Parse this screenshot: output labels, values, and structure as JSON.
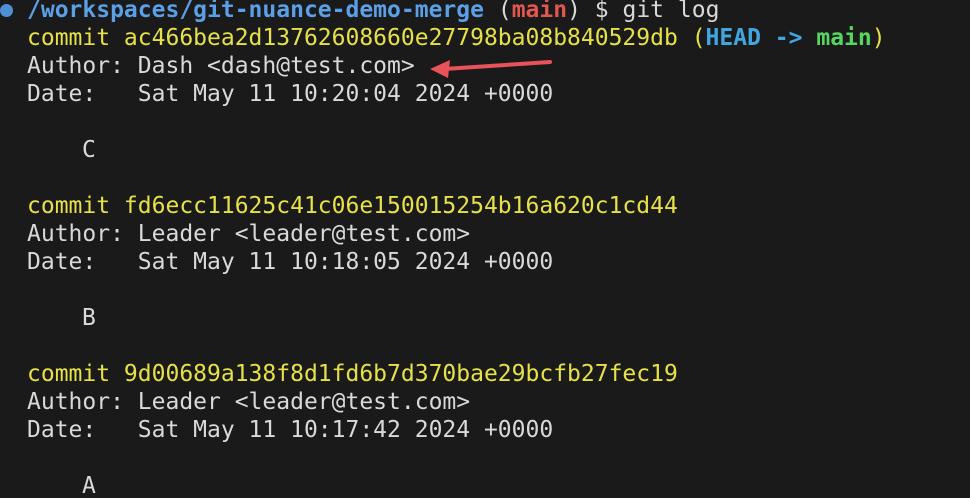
{
  "prompt": {
    "path": "/workspaces/git-nuance-demo-merge",
    "branch": "main",
    "command": "$ git log"
  },
  "colors": {
    "background": "#1a1a1a",
    "text": "#d9d9d9",
    "path": "#5b9fe6",
    "branch": "#e0574f",
    "commit": "#e6e04a",
    "head": "#3fa6e0",
    "main": "#57d462",
    "annotation_arrow": "#e8525a"
  },
  "commits": [
    {
      "commit_line": "commit ac466bea2d13762608660e27798ba08b840529db",
      "head_label": "HEAD",
      "ref_arrow": "->",
      "ref_branch": "main",
      "author": "Author: Dash <dash@test.com>",
      "date": "Date:   Sat May 11 10:20:04 2024 +0000",
      "message": "C"
    },
    {
      "commit_line": "commit fd6ecc11625c41c06e150015254b16a620c1cd44",
      "author": "Author: Leader <leader@test.com>",
      "date": "Date:   Sat May 11 10:18:05 2024 +0000",
      "message": "B"
    },
    {
      "commit_line": "commit 9d00689a138f8d1fd6b7d370bae29bcfb27fec19",
      "author": "Author: Leader <leader@test.com>",
      "date": "Date:   Sat May 11 10:17:42 2024 +0000",
      "message": "A"
    }
  ],
  "annotation": {
    "icon": "red-arrow-icon"
  }
}
